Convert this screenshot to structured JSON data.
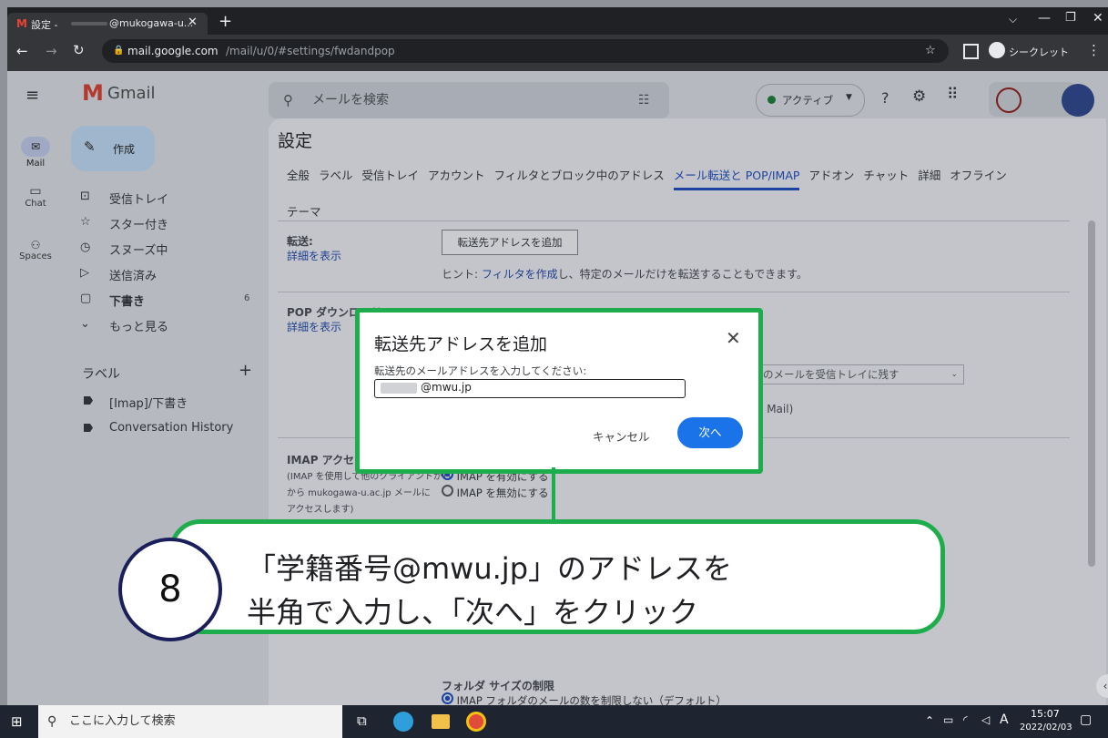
{
  "browser": {
    "tab_title": "設定 - ",
    "tab_account_suffix": "@mukogawa-u...",
    "url_host": "mail.google.com",
    "url_path": "/mail/u/0/#settings/fwdandpop",
    "incognito_label": "シークレット"
  },
  "gmail": {
    "logo_text": "Gmail",
    "rail": [
      {
        "label": "Mail",
        "icon": "mail-icon"
      },
      {
        "label": "Chat",
        "icon": "chat-icon"
      },
      {
        "label": "Spaces",
        "icon": "spaces-icon"
      }
    ],
    "compose_label": "作成",
    "nav_items": [
      {
        "label": "受信トレイ",
        "icon": "inbox-icon",
        "count": ""
      },
      {
        "label": "スター付き",
        "icon": "star-icon",
        "count": ""
      },
      {
        "label": "スヌーズ中",
        "icon": "clock-icon",
        "count": ""
      },
      {
        "label": "送信済み",
        "icon": "send-icon",
        "count": ""
      },
      {
        "label": "下書き",
        "icon": "draft-icon",
        "count": "6"
      },
      {
        "label": "もっと見る",
        "icon": "chevron-down-icon",
        "count": ""
      }
    ],
    "labels_heading": "ラベル",
    "labels": [
      "[Imap]/下書き",
      "Conversation History"
    ],
    "search_placeholder": "メールを検索",
    "status_label": "アクティブ",
    "settings_title": "設定",
    "tabs": [
      "全般",
      "ラベル",
      "受信トレイ",
      "アカウント",
      "フィルタとブロック中のアドレス",
      "メール転送と POP/IMAP",
      "アドオン",
      "チャット",
      "詳細",
      "オフライン"
    ],
    "tabs_row2": [
      "テーマ"
    ],
    "active_tab": "メール転送と POP/IMAP",
    "forwarding": {
      "title": "転送:",
      "link": "詳細を表示",
      "button": "転送先アドレスを追加",
      "hint_prefix": "ヒント: ",
      "hint_link": "フィルタを作成",
      "hint_suffix": "し、特定のメールだけを転送することもできます。"
    },
    "pop": {
      "title": "POP ダウンロード:",
      "link": "詳細を表示",
      "partial_select": "のメールを受信トレイに残す",
      "partial_text": "e Mail)"
    },
    "imap": {
      "title": "IMAP アクセス:",
      "desc_lines": [
        "(IMAP を使用して他のクライアントから",
        "から mukogawa-u.ac.jp メールに",
        "アクセスします)"
      ],
      "opt_enable": "IMAP を有効にする",
      "opt_disable": "IMAP を無効にする"
    },
    "folder_limit": {
      "title": "フォルダ サイズの制限",
      "option": "IMAP フォルダのメールの数を制限しない（デフォルト）"
    }
  },
  "dialog": {
    "title": "転送先アドレスを追加",
    "label": "転送先のメールアドレスを入力してください:",
    "input_value": "@mwu.jp",
    "cancel": "キャンセル",
    "next": "次へ"
  },
  "callout": {
    "step": "8",
    "line1": "「学籍番号@mwu.jp」のアドレスを",
    "line2": "半角で入力し、「次へ」をクリック"
  },
  "taskbar": {
    "search_placeholder": "ここに入力して検索",
    "time": "15:07",
    "date": "2022/02/03"
  },
  "colors": {
    "accent_green": "#1ead4d",
    "gmail_blue": "#1a73e8",
    "step_circle_border": "#1a1f5c"
  }
}
